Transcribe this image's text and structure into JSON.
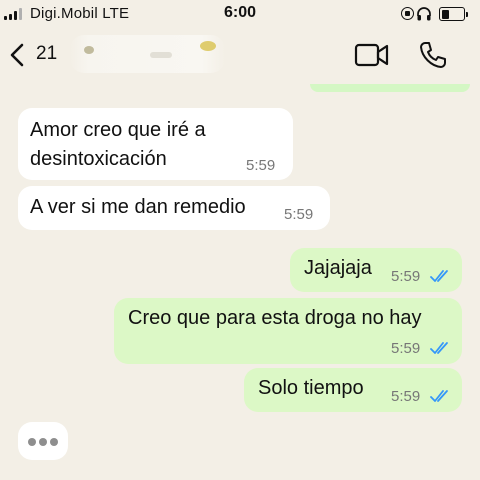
{
  "status_bar": {
    "carrier": "Digi.Mobil  LTE",
    "time": "6:00"
  },
  "header": {
    "unread_count": "21",
    "contact_name": ""
  },
  "messages": [
    {
      "direction": "incoming",
      "lines": [
        "Amor creo que iré a",
        "desintoxicación"
      ],
      "time": "5:59"
    },
    {
      "direction": "incoming",
      "lines": [
        "A ver si me dan remedio"
      ],
      "time": "5:59"
    },
    {
      "direction": "outgoing",
      "lines": [
        "Jajajaja"
      ],
      "time": "5:59",
      "status": "read"
    },
    {
      "direction": "outgoing",
      "lines": [
        "Creo que para esta droga no hay"
      ],
      "time": "5:59",
      "status": "read"
    },
    {
      "direction": "outgoing",
      "lines": [
        "Solo tiempo"
      ],
      "time": "5:59",
      "status": "read"
    }
  ],
  "typing_indicator": true,
  "colors": {
    "background": "#f3efe6",
    "incoming_bubble": "#ffffff",
    "outgoing_bubble": "#dcf8c6",
    "read_ticks": "#3497f9"
  },
  "icons": [
    "back-chevron-icon",
    "video-call-icon",
    "phone-call-icon",
    "signal-icon",
    "headphones-icon",
    "battery-icon",
    "rotation-lock-icon"
  ]
}
